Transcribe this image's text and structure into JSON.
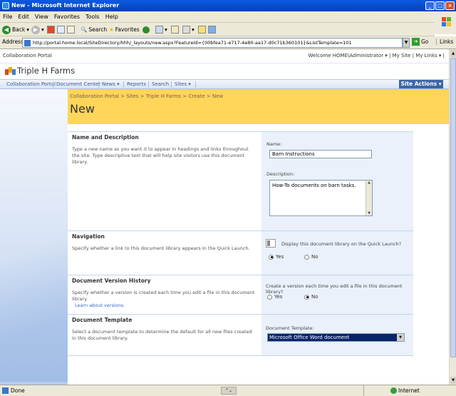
{
  "window": {
    "title": "New - Microsoft Internet Explorer"
  },
  "menu": [
    "File",
    "Edit",
    "View",
    "Favorites",
    "Tools",
    "Help"
  ],
  "toolbar": {
    "back": "Back",
    "search": "Search",
    "favorites": "Favorites"
  },
  "address": {
    "label": "Address",
    "url": "http://portal.home.local/SiteDirectory/hhh/_layouts/new.aspx?FeatureId={00bfea71-e717-4e80-aa17-d0c71b360101}&ListTemplate=101",
    "go": "Go",
    "links": "Links"
  },
  "sp": {
    "portal_link": "Collaboration Portal",
    "welcome": "Welcome HOME\\Administrator ▾  |  My Site  |  My Links ▾  |",
    "site_title": "Triple H Farms",
    "nav": [
      "Collaboration Portal",
      "Document Center",
      "News ▾",
      "Reports",
      "Search",
      "Sites ▾"
    ],
    "site_actions": "Site Actions ▾",
    "breadcrumb": "Collaboration Portal > Sites > Triple H Farms > Create > New",
    "page_title": "New"
  },
  "form": {
    "name_section": {
      "heading": "Name and Description",
      "desc": "Type a new name as you want it to appear in headings and links throughout the site. Type descriptive text that will help site visitors use this document library.",
      "name_label": "Name:",
      "name_value": "Barn Instructions",
      "desc_label": "Description:",
      "desc_value": "How-To documents on barn tasks."
    },
    "nav_section": {
      "heading": "Navigation",
      "desc": "Specify whether a link to this document library appears in the Quick Launch.",
      "question": "Display this document library on the Quick Launch?",
      "yes": "Yes",
      "no": "No",
      "selected": "Yes"
    },
    "version_section": {
      "heading": "Document Version History",
      "desc": "Specify whether a version is created each time you edit a file in this document library.",
      "learn": "Learn about versions.",
      "question": "Create a version each time you edit a file in this document library?",
      "yes": "Yes",
      "no": "No",
      "selected": "No"
    },
    "template_section": {
      "heading": "Document Template",
      "desc": "Select a document template to determine the default for all new files created in this document library.",
      "label": "Document Template:",
      "value": "Microsoft Office Word document"
    }
  },
  "status": {
    "left": "Done",
    "right": "Internet"
  }
}
